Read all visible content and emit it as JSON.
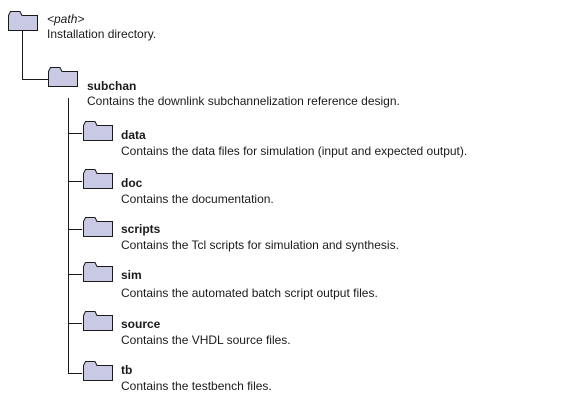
{
  "tree": {
    "root": {
      "name": "<path>",
      "desc": "Installation directory."
    },
    "subchan": {
      "name": "subchan",
      "desc": "Contains the downlink subchannelization reference design."
    },
    "children": [
      {
        "name": "data",
        "desc": "Contains the data files for simulation (input and expected output)."
      },
      {
        "name": "doc",
        "desc": "Contains the documentation."
      },
      {
        "name": "scripts",
        "desc": "Contains the Tcl scripts for simulation and synthesis."
      },
      {
        "name": "sim",
        "desc": "Contains the automated batch script output files."
      },
      {
        "name": "source",
        "desc": "Contains the VHDL source files."
      },
      {
        "name": "tb",
        "desc": "Contains the testbench files."
      }
    ]
  },
  "colors": {
    "folder_fill": "#c9c9e3",
    "folder_stroke": "#1a1a1a",
    "line": "#1a1a1a"
  },
  "icons": {
    "folder": "folder-icon"
  }
}
